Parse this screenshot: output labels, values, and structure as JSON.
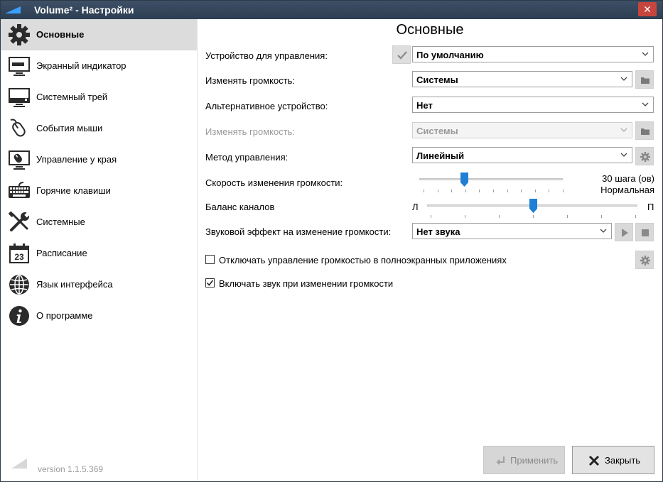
{
  "window": {
    "title": "Volume² - Настройки",
    "close_glyph": "✕"
  },
  "sidebar": {
    "items": [
      {
        "label": "Основные",
        "icon": "gear-icon",
        "active": true
      },
      {
        "label": "Экранный индикатор",
        "icon": "monitor-indicator-icon"
      },
      {
        "label": "Системный трей",
        "icon": "monitor-tray-icon"
      },
      {
        "label": "События мыши",
        "icon": "mouse-icon"
      },
      {
        "label": "Управление у края",
        "icon": "screen-edge-mouse-icon"
      },
      {
        "label": "Горячие клавиши",
        "icon": "keyboard-icon"
      },
      {
        "label": "Системные",
        "icon": "tools-icon"
      },
      {
        "label": "Расписание",
        "icon": "calendar-icon"
      },
      {
        "label": "Язык интерфейса",
        "icon": "globe-icon"
      },
      {
        "label": "О программе",
        "icon": "info-icon"
      }
    ],
    "calendar_day": "23",
    "logo_sup": "2",
    "version": "version 1.1.5.369"
  },
  "main": {
    "title": "Основные",
    "device_label": "Устройство для управления:",
    "device_value": "По умолчанию",
    "volume_label": "Изменять громкость:",
    "volume_value": "Системы",
    "alt_device_label": "Альтернативное устройство:",
    "alt_device_value": "Нет",
    "alt_volume_label": "Изменять громкость:",
    "alt_volume_value": "Системы",
    "method_label": "Метод управления:",
    "method_value": "Линейный",
    "speed_label": "Скорость изменения громкости:",
    "speed_value_line1": "30 шага (ов)",
    "speed_value_line2": "Нормальная",
    "speed_fraction": 0.29,
    "balance_label": "Баланс каналов",
    "balance_left": "Л",
    "balance_right": "П",
    "balance_fraction": 0.5,
    "sound_label": "Звуковой эффект на изменение громкости:",
    "sound_value": "Нет звука",
    "fullscreen_label": "Отключать управление громкостью в полноэкранных приложениях",
    "fullscreen_checked": false,
    "enable_sound_label": "Включать звук при изменении громкости",
    "enable_sound_checked": true
  },
  "footer": {
    "apply_label": "Применить",
    "close_label": "Закрыть"
  },
  "colors": {
    "accent": "#1e7fd4",
    "titlebar": "#34465b",
    "close": "#c7453f"
  }
}
